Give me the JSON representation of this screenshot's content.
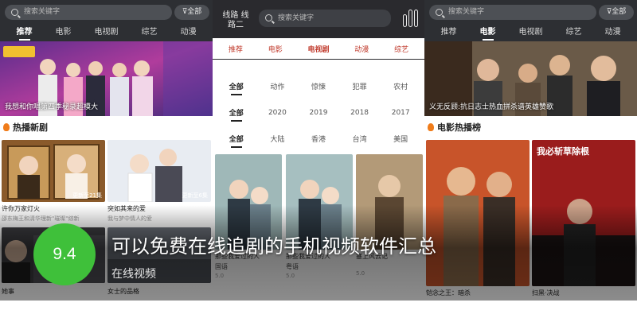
{
  "left": {
    "search_placeholder": "搜索关键字",
    "all_label": "全部",
    "tabs": [
      "推荐",
      "电影",
      "电视剧",
      "综艺",
      "动漫"
    ],
    "banner_caption": "我想和你唱第四季秘录超模大",
    "section_title": "热播新剧",
    "cards": [
      {
        "title": "许你万家灯火",
        "sub": "邵东梅王和清华理新\"璀璨\"综新",
        "badge": "更新至21集"
      },
      {
        "title": "突如其来的爱",
        "sub": "我与梦中情人的爱",
        "badge": "更新至6集"
      },
      {
        "title": "她事",
        "sub": ""
      },
      {
        "title": "女士的品格",
        "sub": ""
      }
    ]
  },
  "middle": {
    "line_label": "线路 线路二",
    "search_placeholder": "搜索关键字",
    "tabs": [
      "推荐",
      "电影",
      "电视剧",
      "动漫",
      "综艺"
    ],
    "filter_rows": [
      [
        "全部",
        "动作",
        "惊悚",
        "犯罪",
        "农村"
      ],
      [
        "全部",
        "2020",
        "2019",
        "2018",
        "2017"
      ],
      [
        "全部",
        "大陆",
        "香港",
        "台湾",
        "美国"
      ]
    ],
    "cards": [
      {
        "title": "那些我爱过的人",
        "sub": "国语",
        "score": "5.0"
      },
      {
        "title": "那些我爱过的人",
        "sub": "粤语",
        "score": "5.0"
      },
      {
        "title": "塞上风云记",
        "sub": "",
        "score": "5.0"
      }
    ]
  },
  "right": {
    "search_placeholder": "搜索关键字",
    "all_label": "全部",
    "tabs": [
      "推荐",
      "电影",
      "电视剧",
      "综艺",
      "动漫"
    ],
    "banner_caption": "义无反顾:抗日志士热血拼杀谱英雄赞歌",
    "section_title": "电影热播榜",
    "cards": [
      {
        "title": "铠念之王：暗杀",
        "sub": "",
        "poster_text": ""
      },
      {
        "title": "扫黑·决战",
        "sub": "",
        "poster_text": "我必斩草除根"
      }
    ]
  },
  "overlay": {
    "score": "9.4",
    "title": "可以免费在线追剧的手机视频软件汇总",
    "subtitle": "在线视频"
  },
  "colors": {
    "header_bg": "#2d2f33",
    "accent_red": "#c0392b",
    "score_green": "#3fc03a"
  }
}
